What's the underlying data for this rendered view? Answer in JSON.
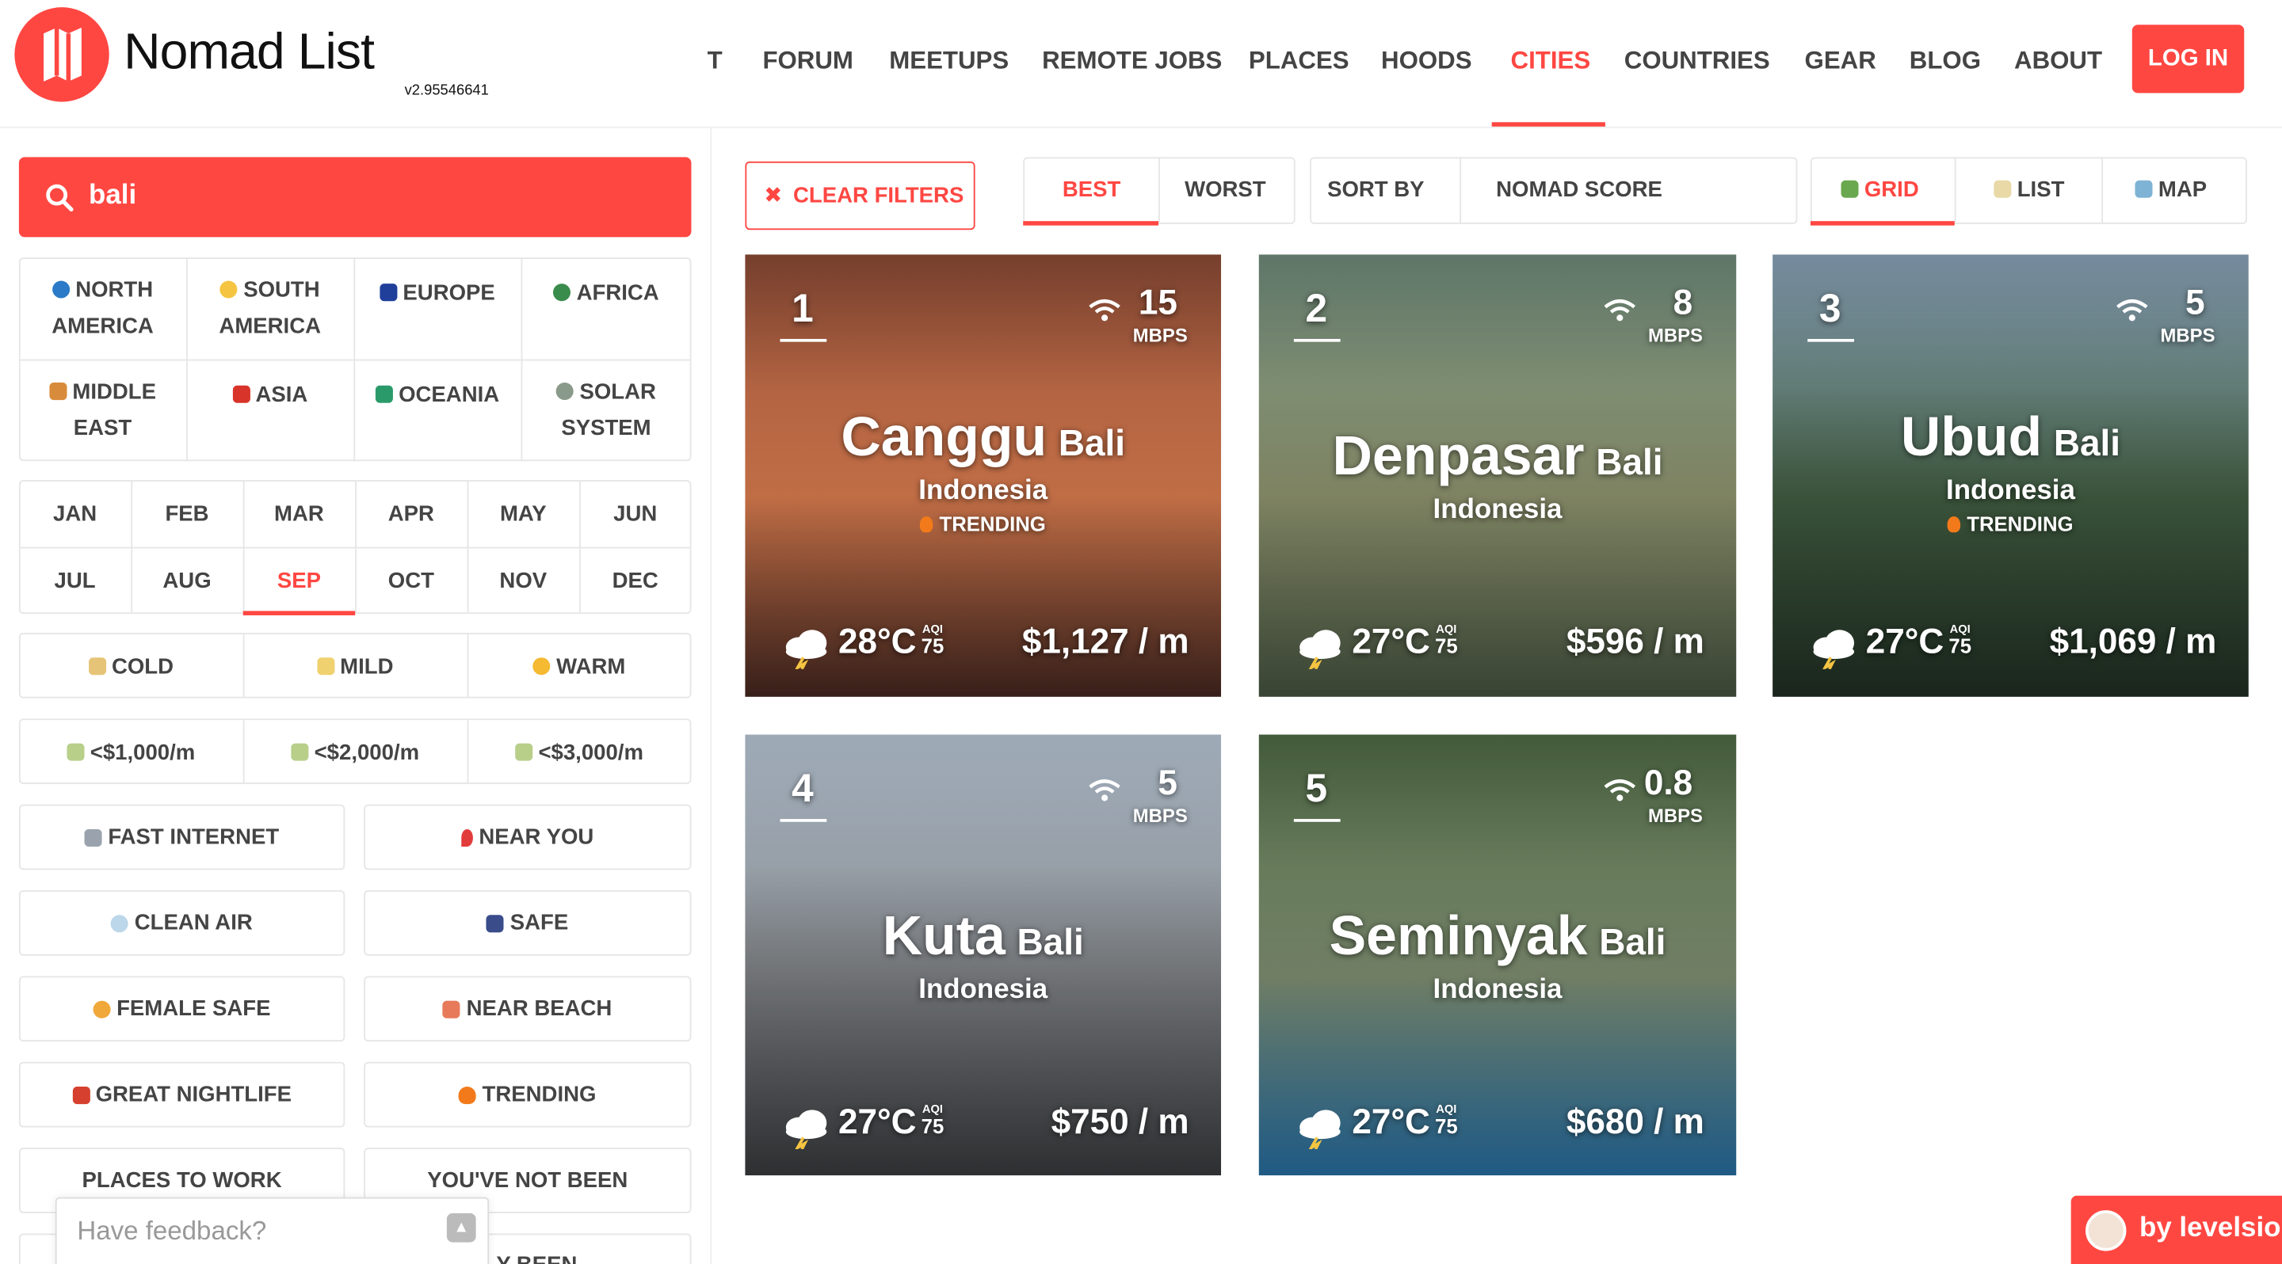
{
  "brand": {
    "name": "Nomad List",
    "version": "v2.95546641"
  },
  "nav": {
    "items": [
      "T",
      "FORUM",
      "MEETUPS",
      "REMOTE JOBS",
      "PLACES",
      "HOODS",
      "CITIES",
      "COUNTRIES",
      "GEAR",
      "BLOG",
      "ABOUT"
    ],
    "active": "CITIES",
    "login": "LOG IN"
  },
  "search": {
    "value": "bali",
    "icon": "search-icon"
  },
  "regions": [
    {
      "l1": "NORTH",
      "l2": "AMERICA",
      "icon": "globe-americas-icon"
    },
    {
      "l1": "SOUTH",
      "l2": "AMERICA",
      "icon": "sun-icon"
    },
    {
      "l1": "EUROPE",
      "l2": "",
      "icon": "eu-flag-icon"
    },
    {
      "l1": "AFRICA",
      "l2": "",
      "icon": "globe-africa-icon"
    },
    {
      "l1": "MIDDLE",
      "l2": "EAST",
      "icon": "mosque-icon"
    },
    {
      "l1": "ASIA",
      "l2": "",
      "icon": "torii-icon"
    },
    {
      "l1": "OCEANIA",
      "l2": "",
      "icon": "surfer-icon"
    },
    {
      "l1": "SOLAR",
      "l2": "SYSTEM",
      "icon": "alien-icon"
    }
  ],
  "months": [
    "JAN",
    "FEB",
    "MAR",
    "APR",
    "MAY",
    "JUN",
    "JUL",
    "AUG",
    "SEP",
    "OCT",
    "NOV",
    "DEC"
  ],
  "active_month": "SEP",
  "climate": [
    {
      "label": "COLD",
      "icon": "cold-icon"
    },
    {
      "label": "MILD",
      "icon": "mild-icon"
    },
    {
      "label": "WARM",
      "icon": "sun-icon"
    }
  ],
  "budget": [
    {
      "label": "<$1,000/m",
      "icon": "money-icon"
    },
    {
      "label": "<$2,000/m",
      "icon": "money-icon"
    },
    {
      "label": "<$3,000/m",
      "icon": "money-icon"
    }
  ],
  "tags": [
    {
      "label": "FAST INTERNET",
      "icon": "satellite-icon"
    },
    {
      "label": "NEAR YOU",
      "icon": "pin-icon"
    },
    {
      "label": "CLEAN AIR",
      "icon": "wind-icon"
    },
    {
      "label": "SAFE",
      "icon": "police-icon"
    },
    {
      "label": "FEMALE SAFE",
      "icon": "woman-icon"
    },
    {
      "label": "NEAR BEACH",
      "icon": "beach-icon"
    },
    {
      "label": "GREAT NIGHTLIFE",
      "icon": "dancer-icon"
    },
    {
      "label": "TRENDING",
      "icon": "fire-icon"
    },
    {
      "label": "PLACES TO WORK",
      "icon": ""
    },
    {
      "label": "YOU'VE NOT BEEN",
      "icon": ""
    },
    {
      "label": "",
      "icon": ""
    },
    {
      "label": "Y BEEN",
      "icon": ""
    }
  ],
  "toolbar": {
    "clear_filters": "CLEAR FILTERS",
    "best": "BEST",
    "worst": "WORST",
    "sort_by": "SORT BY",
    "sort_value": "NOMAD SCORE",
    "grid": "GRID",
    "list": "LIST",
    "map": "MAP"
  },
  "cities": [
    {
      "rank": "1",
      "name": "Canggu",
      "region": "Bali",
      "country": "Indonesia",
      "trending": "TRENDING",
      "mbps": "15",
      "mbps_label": "MBPS",
      "temp": "28°C",
      "aqi_label": "AQI",
      "aqi": "75",
      "cost": "$1,127 / m",
      "colors": [
        "#8a4a35",
        "#d3784c",
        "#4a2a22"
      ]
    },
    {
      "rank": "2",
      "name": "Denpasar",
      "region": "Bali",
      "country": "Indonesia",
      "trending": "",
      "mbps": "8",
      "mbps_label": "MBPS",
      "temp": "27°C",
      "aqi_label": "AQI",
      "aqi": "75",
      "cost": "$596 / m",
      "colors": [
        "#6f8a7a",
        "#8a8f6b",
        "#4b5a45"
      ]
    },
    {
      "rank": "3",
      "name": "Ubud",
      "region": "Bali",
      "country": "Indonesia",
      "trending": "TRENDING",
      "mbps": "5",
      "mbps_label": "MBPS",
      "temp": "27°C",
      "aqi_label": "AQI",
      "aqi": "75",
      "cost": "$1,069 / m",
      "colors": [
        "#8aa3b8",
        "#3f5a3f",
        "#233326"
      ]
    },
    {
      "rank": "4",
      "name": "Kuta",
      "region": "Bali",
      "country": "Indonesia",
      "trending": "",
      "mbps": "5",
      "mbps_label": "MBPS",
      "temp": "27°C",
      "aqi_label": "AQI",
      "aqi": "75",
      "cost": "$750 / m",
      "colors": [
        "#b9c7d6",
        "#7a7d80",
        "#3d3f42"
      ]
    },
    {
      "rank": "5",
      "name": "Seminyak",
      "region": "Bali",
      "country": "Indonesia",
      "trending": "",
      "mbps": "0.8",
      "mbps_label": "MBPS",
      "temp": "27°C",
      "aqi_label": "AQI",
      "aqi": "75",
      "cost": "$680 / m",
      "colors": [
        "#4f6a45",
        "#7b8a6e",
        "#2a78b0"
      ]
    }
  ],
  "feedback": {
    "placeholder": "Have feedback?"
  },
  "byline": "by levelsio",
  "accent": "#ff4742"
}
